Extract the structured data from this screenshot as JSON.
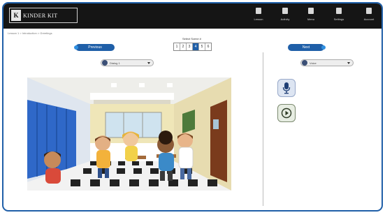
{
  "header": {
    "logo_mark": "K",
    "logo_text": "KINDER KIT",
    "nav": [
      {
        "label": "Lesson",
        "icon": "person-icon"
      },
      {
        "label": "Activity",
        "icon": "home-icon"
      },
      {
        "label": "Menu",
        "icon": "book-icon"
      },
      {
        "label": "Settings",
        "icon": "monitor-icon"
      },
      {
        "label": "Account",
        "icon": "user-icon"
      }
    ]
  },
  "breadcrumb": "Lesson 1 > Introduction > Greetings",
  "left_panel": {
    "previous_label": "Previous",
    "slide_label": "Select Scene #",
    "pages": [
      "1",
      "2",
      "3",
      "4",
      "5",
      "6"
    ],
    "active_page_index": 3,
    "dialog_select": "Dialog 1"
  },
  "right_panel": {
    "next_label": "Next",
    "voice_select": "Voice"
  },
  "colors": {
    "brand_blue": "#1f5fa8",
    "topbar": "#151515",
    "frame": "#1f5fa8"
  }
}
